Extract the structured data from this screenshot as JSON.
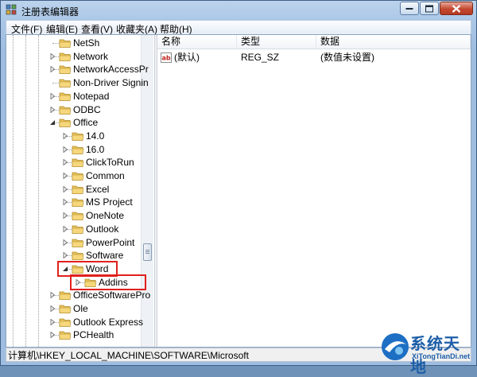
{
  "window": {
    "title": "注册表编辑器"
  },
  "menu": [
    "文件(F)",
    "编辑(E)",
    "查看(V)",
    "收藏夹(A)",
    "帮助(H)"
  ],
  "tree": [
    {
      "label": "NetSh",
      "level": 1,
      "expander": "none"
    },
    {
      "label": "Network",
      "level": 1,
      "expander": "collapsed"
    },
    {
      "label": "NetworkAccessPr",
      "level": 1,
      "expander": "collapsed"
    },
    {
      "label": "Non-Driver Signin",
      "level": 1,
      "expander": "none"
    },
    {
      "label": "Notepad",
      "level": 1,
      "expander": "collapsed"
    },
    {
      "label": "ODBC",
      "level": 1,
      "expander": "collapsed"
    },
    {
      "label": "Office",
      "level": 1,
      "expander": "expanded"
    },
    {
      "label": "14.0",
      "level": 2,
      "expander": "collapsed"
    },
    {
      "label": "16.0",
      "level": 2,
      "expander": "collapsed"
    },
    {
      "label": "ClickToRun",
      "level": 2,
      "expander": "collapsed"
    },
    {
      "label": "Common",
      "level": 2,
      "expander": "collapsed"
    },
    {
      "label": "Excel",
      "level": 2,
      "expander": "collapsed"
    },
    {
      "label": "MS Project",
      "level": 2,
      "expander": "collapsed"
    },
    {
      "label": "OneNote",
      "level": 2,
      "expander": "collapsed"
    },
    {
      "label": "Outlook",
      "level": 2,
      "expander": "collapsed"
    },
    {
      "label": "PowerPoint",
      "level": 2,
      "expander": "collapsed"
    },
    {
      "label": "Software",
      "level": 2,
      "expander": "collapsed"
    },
    {
      "label": "Word",
      "level": 2,
      "expander": "expanded",
      "highlight": true
    },
    {
      "label": "Addins",
      "level": 3,
      "expander": "collapsed",
      "highlight": true
    },
    {
      "label": "OfficeSoftwarePro",
      "level": 1,
      "expander": "collapsed"
    },
    {
      "label": "Ole",
      "level": 1,
      "expander": "collapsed"
    },
    {
      "label": "Outlook Express",
      "level": 1,
      "expander": "collapsed"
    },
    {
      "label": "PCHealth",
      "level": 1,
      "expander": "collapsed"
    }
  ],
  "list": {
    "columns": [
      "名称",
      "类型",
      "数据"
    ],
    "rows": [
      {
        "icon": "string-value-icon",
        "icon_text": "ab",
        "name": "(默认)",
        "type": "REG_SZ",
        "data": "(数值未设置)"
      }
    ]
  },
  "status": {
    "path": "计算机\\HKEY_LOCAL_MACHINE\\SOFTWARE\\Microsoft"
  },
  "watermark": {
    "main": "系统天地",
    "sub": "XiTongTianDi.net"
  },
  "colors": {
    "highlight_box": "#e0201c",
    "folder": "#e8c25a",
    "watermark": "#1d5ea8"
  }
}
